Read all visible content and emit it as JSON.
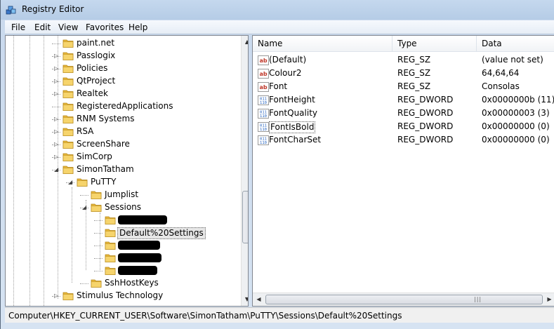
{
  "window": {
    "title": "Registry Editor"
  },
  "menu": [
    "File",
    "Edit",
    "View",
    "Favorites",
    "Help"
  ],
  "tree": {
    "items": [
      {
        "label": "paint.net",
        "expander": ""
      },
      {
        "label": "Passlogix",
        "expander": "▷"
      },
      {
        "label": "Policies",
        "expander": "▷"
      },
      {
        "label": "QtProject",
        "expander": "▷"
      },
      {
        "label": "Realtek",
        "expander": "▷"
      },
      {
        "label": "RegisteredApplications",
        "expander": ""
      },
      {
        "label": "RNM Systems",
        "expander": "▷"
      },
      {
        "label": "RSA",
        "expander": "▷"
      },
      {
        "label": "ScreenShare",
        "expander": "▷"
      },
      {
        "label": "SimCorp",
        "expander": "▷"
      },
      {
        "label": "SimonTatham",
        "expander": "◢"
      },
      {
        "label": "PuTTY",
        "expander": "◢"
      },
      {
        "label": "Jumplist",
        "expander": ""
      },
      {
        "label": "Sessions",
        "expander": "◢"
      },
      {
        "label": "",
        "expander": ""
      },
      {
        "label": "Default%20Settings",
        "expander": ""
      },
      {
        "label": "",
        "expander": ""
      },
      {
        "label": "",
        "expander": ""
      },
      {
        "label": "",
        "expander": ""
      },
      {
        "label": "SshHostKeys",
        "expander": ""
      },
      {
        "label": "Stimulus Technology",
        "expander": "▷"
      }
    ],
    "selected": "Default%20Settings"
  },
  "list": {
    "columns": [
      "Name",
      "Type",
      "Data"
    ],
    "rows": [
      {
        "name": "(Default)",
        "type": "REG_SZ",
        "data": "(value not set)",
        "icon": "string-value-icon"
      },
      {
        "name": "Colour2",
        "type": "REG_SZ",
        "data": "64,64,64",
        "icon": "string-value-icon"
      },
      {
        "name": "Font",
        "type": "REG_SZ",
        "data": "Consolas",
        "icon": "string-value-icon"
      },
      {
        "name": "FontHeight",
        "type": "REG_DWORD",
        "data": "0x0000000b (11)",
        "icon": "dword-value-icon"
      },
      {
        "name": "FontQuality",
        "type": "REG_DWORD",
        "data": "0x00000003 (3)",
        "icon": "dword-value-icon"
      },
      {
        "name": "FontIsBold",
        "type": "REG_DWORD",
        "data": "0x00000000 (0)",
        "icon": "dword-value-icon"
      },
      {
        "name": "FontCharSet",
        "type": "REG_DWORD",
        "data": "0x00000000 (0)",
        "icon": "dword-value-icon"
      }
    ],
    "focused_row": "FontIsBold"
  },
  "scroll": {
    "grip": "|||"
  },
  "status": {
    "path": "Computer\\HKEY_CURRENT_USER\\Software\\SimonTatham\\PuTTY\\Sessions\\Default%20Settings"
  },
  "colors": {
    "title_bar": "#b9d1ea",
    "folder": "#f0c24b",
    "string_icon": "#c0392b",
    "dword_icon": "#1f5fbf"
  }
}
